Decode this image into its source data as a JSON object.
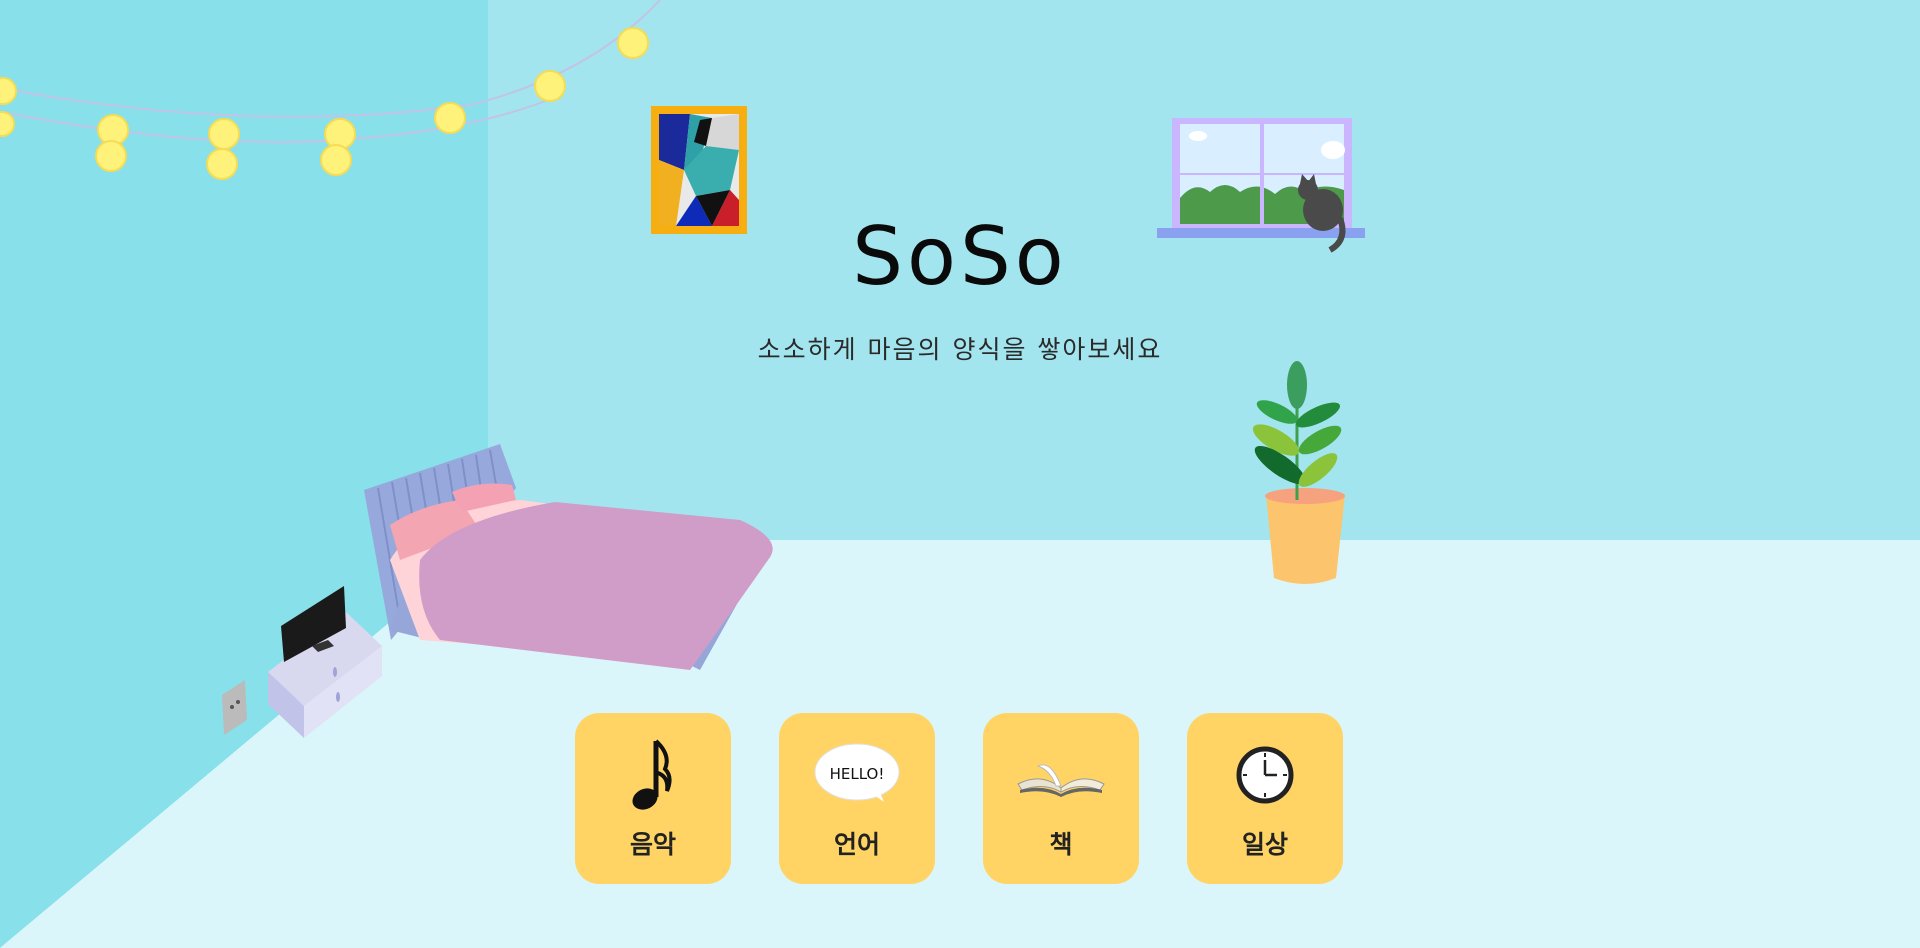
{
  "header": {
    "title": "SoSo",
    "subtitle": "소소하게 마음의 양식을 쌓아보세요"
  },
  "menu": {
    "items": [
      {
        "label": "음악",
        "icon": "music-note-icon"
      },
      {
        "label": "언어",
        "icon": "hello-speech-bubble-icon",
        "icon_text": "HELLO!"
      },
      {
        "label": "책",
        "icon": "open-book-icon"
      },
      {
        "label": "일상",
        "icon": "clock-icon"
      }
    ]
  },
  "colors": {
    "wall_back": "#a2e5ee",
    "wall_left": "#88e0ea",
    "floor": "#daf6fa",
    "card": "#ffd465",
    "bed_blanket": "#d09cc8",
    "bed_frame": "#98a9dc"
  }
}
